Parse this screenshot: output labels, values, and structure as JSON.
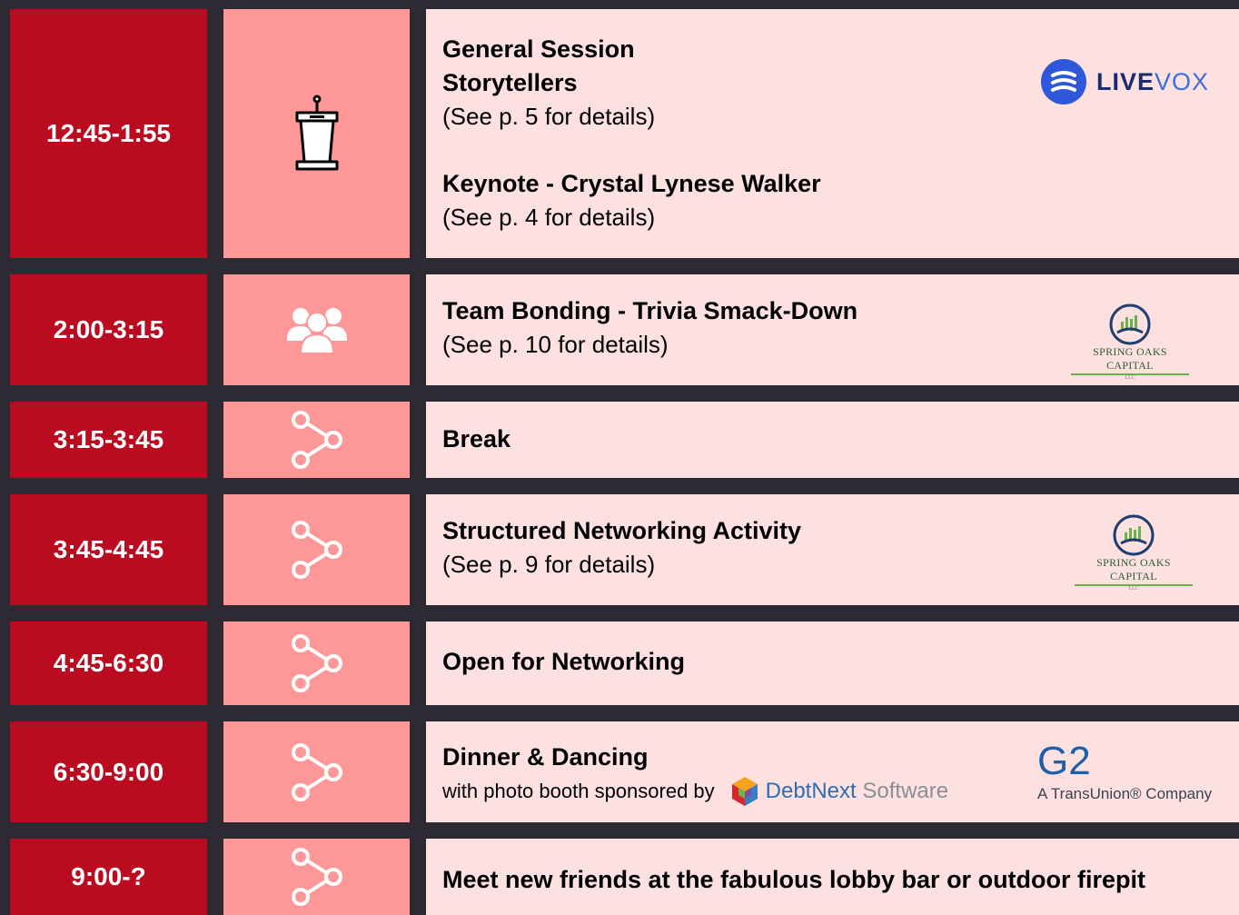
{
  "rows": [
    {
      "time": "12:45-1:55",
      "icon": "podium-icon",
      "title1": "General Session",
      "title2": "Storytellers",
      "detail1": "(See p. 5 for details)",
      "title3": "Keynote - Crystal Lynese Walker",
      "detail2": "(See p. 4 for details)",
      "sponsor": {
        "name": "LIVEVOX",
        "part1": "LIVE",
        "part2": "VOX"
      }
    },
    {
      "time": "2:00-3:15",
      "icon": "group-icon",
      "title": "Team Bonding - Trivia Smack-Down",
      "detail": "(See p. 10 for details)",
      "sponsor": {
        "name": "SPRING OAKS CAPITAL",
        "llc": "LLC"
      }
    },
    {
      "time": "3:15-3:45",
      "icon": "share-icon",
      "title": "Break"
    },
    {
      "time": "3:45-4:45",
      "icon": "share-icon",
      "title": "Structured Networking Activity",
      "detail": "(See p. 9 for details)",
      "sponsor": {
        "name": "SPRING OAKS CAPITAL",
        "llc": "LLC"
      }
    },
    {
      "time": "4:45-6:30",
      "icon": "share-icon",
      "title": "Open for Networking"
    },
    {
      "time": "6:30-9:00",
      "icon": "share-icon",
      "title": "Dinner & Dancing",
      "detail": "with photo booth sponsored by",
      "sponsor1": {
        "name1": "DebtNext",
        "name2": " Software"
      },
      "sponsor2": {
        "mark": "G2",
        "tagline": "A TransUnion® Company"
      }
    },
    {
      "time": "9:00-?",
      "icon": "share-icon",
      "title": "Meet new friends at the fabulous lobby bar or outdoor firepit"
    }
  ],
  "colors": {
    "background": "#2d2a33",
    "time_cell": "#bb0b20",
    "icon_cell": "#fe9898",
    "content_cell": "#fde1e1",
    "livevox_blue": "#2f57d9",
    "g2_blue": "#1d5fa8"
  }
}
